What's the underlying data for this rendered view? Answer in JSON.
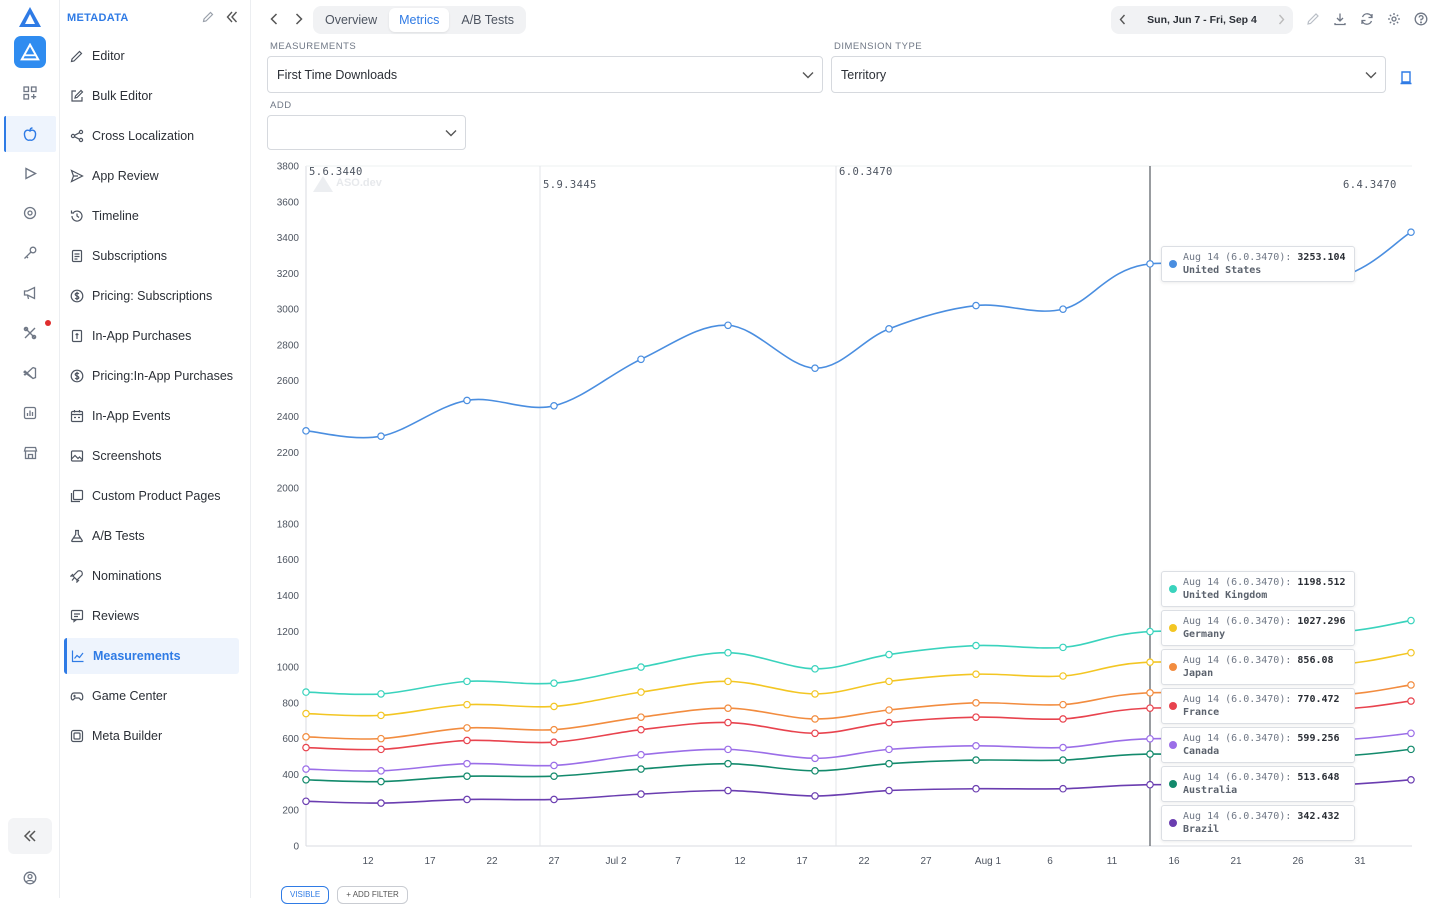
{
  "sidebar": {
    "header": "METADATA",
    "items": [
      {
        "label": "Editor",
        "icon": "pencil-icon"
      },
      {
        "label": "Bulk Editor",
        "icon": "edit-square-icon"
      },
      {
        "label": "Cross Localization",
        "icon": "share-icon"
      },
      {
        "label": "App Review",
        "icon": "send-icon"
      },
      {
        "label": "Timeline",
        "icon": "history-icon"
      },
      {
        "label": "Subscriptions",
        "icon": "document-icon"
      },
      {
        "label": "Pricing: Subscriptions",
        "icon": "dollar-circle-icon"
      },
      {
        "label": "In-App Purchases",
        "icon": "receipt-icon"
      },
      {
        "label": "Pricing:In-App Purchases",
        "icon": "dollar-circle-icon"
      },
      {
        "label": "In-App Events",
        "icon": "calendar-icon"
      },
      {
        "label": "Screenshots",
        "icon": "image-icon"
      },
      {
        "label": "Custom Product Pages",
        "icon": "pages-icon"
      },
      {
        "label": "A/B Tests",
        "icon": "flask-icon"
      },
      {
        "label": "Nominations",
        "icon": "rocket-icon"
      },
      {
        "label": "Reviews",
        "icon": "review-icon"
      },
      {
        "label": "Measurements",
        "icon": "chart-icon",
        "active": true
      },
      {
        "label": "Game Center",
        "icon": "gamepad-icon"
      },
      {
        "label": "Meta Builder",
        "icon": "layers-icon"
      }
    ]
  },
  "topbar": {
    "tabs": [
      {
        "label": "Overview"
      },
      {
        "label": "Metrics",
        "active": true
      },
      {
        "label": "A/B Tests"
      }
    ],
    "date_range": "Sun, Jun 7 - Fri, Sep 4"
  },
  "filters": {
    "measurements_label": "MEASUREMENTS",
    "measurements_value": "First Time Downloads",
    "dimension_label": "DIMENSION TYPE",
    "dimension_value": "Territory",
    "add_label": "ADD",
    "add_value": ""
  },
  "bottom": {
    "visible_label": "VISIBLE",
    "add_filter_label": "+ ADD FILTER"
  },
  "colors": {
    "accent": "#2f7be5",
    "United States": "#4a8ee0",
    "United Kingdom": "#3ad3bd",
    "Germany": "#f3c623",
    "Japan": "#f28c3f",
    "France": "#e8434e",
    "Canada": "#9b6ee8",
    "Australia": "#138a6c",
    "Brazil": "#6a3db0"
  },
  "chart_data": {
    "type": "line",
    "watermark": "ASO.dev",
    "ylim": [
      0,
      3800
    ],
    "yticks": [
      0,
      200,
      400,
      600,
      800,
      1000,
      1200,
      1400,
      1600,
      1800,
      2000,
      2200,
      2400,
      2600,
      2800,
      3000,
      3200,
      3400,
      3600,
      3800
    ],
    "xticks": [
      "12",
      "17",
      "22",
      "27",
      "Jul 2",
      "7",
      "12",
      "17",
      "22",
      "27",
      "Aug 1",
      "6",
      "11",
      "16",
      "21",
      "26",
      "31"
    ],
    "versions": [
      "5.6.3440",
      "5.9.3445",
      "6.0.3470",
      "6.4.3470"
    ],
    "hover_label": "Aug 14 (6.0.3470):",
    "series": [
      {
        "name": "United States",
        "values": [
          2320,
          2290,
          2490,
          2460,
          2720,
          2910,
          2670,
          2890,
          3020,
          3000,
          3253.104,
          3160,
          3430
        ],
        "tooltip": "3253.104"
      },
      {
        "name": "United Kingdom",
        "values": [
          860,
          850,
          920,
          910,
          1000,
          1080,
          990,
          1070,
          1120,
          1110,
          1198.512,
          1190,
          1260
        ],
        "tooltip": "1198.512"
      },
      {
        "name": "Germany",
        "values": [
          740,
          730,
          790,
          780,
          860,
          920,
          850,
          920,
          960,
          950,
          1027.296,
          1010,
          1080
        ],
        "tooltip": "1027.296"
      },
      {
        "name": "Japan",
        "values": [
          610,
          600,
          660,
          650,
          720,
          770,
          710,
          760,
          800,
          790,
          856.08,
          840,
          900
        ],
        "tooltip": "856.08"
      },
      {
        "name": "France",
        "values": [
          550,
          540,
          590,
          580,
          650,
          690,
          630,
          690,
          720,
          710,
          770.472,
          760,
          810
        ],
        "tooltip": "770.472"
      },
      {
        "name": "Canada",
        "values": [
          430,
          420,
          460,
          450,
          510,
          540,
          490,
          540,
          560,
          550,
          599.256,
          590,
          630
        ],
        "tooltip": "599.256"
      },
      {
        "name": "Australia",
        "values": [
          370,
          360,
          390,
          390,
          430,
          460,
          420,
          460,
          480,
          480,
          513.648,
          500,
          540
        ],
        "tooltip": "513.648"
      },
      {
        "name": "Brazil",
        "values": [
          250,
          240,
          260,
          260,
          290,
          310,
          280,
          310,
          320,
          320,
          342.432,
          340,
          370
        ],
        "tooltip": "342.432"
      }
    ]
  }
}
